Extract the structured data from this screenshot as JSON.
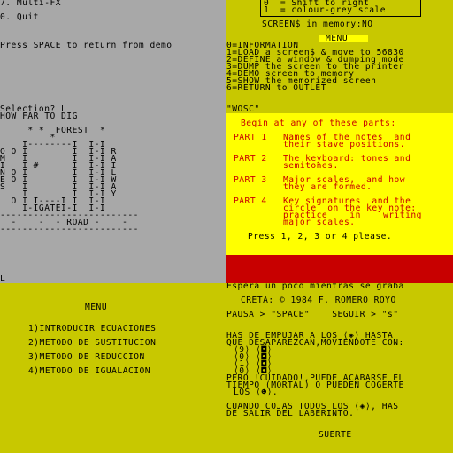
{
  "tl": {
    "line1": "7. Multi-FX",
    "line2": "0. Quit",
    "press": "Press SPACE to return from demo",
    "selection": "Selection? L",
    "dig": "HOW FAR TO DIG",
    "map": [
      "     * *  FOREST  *",
      "         *",
      "    I--------I  I-I",
      "O O I        I  I-I R",
      "M   I        I  I-I A",
      "I   I #      I  I-I I",
      "N O I        I  I-I L",
      "E O I        I  I-I W",
      "S   I        I  I-I A",
      "    I        I  I-I Y",
      "  O I I----I I  I-I",
      "    I-IGATEI-I  I-I",
      "-------------------------",
      "  -    -  - ROAD -    -",
      "-------------------------"
    ],
    "cursor": "L"
  },
  "tr": {
    "box1": "0  = Shift to right",
    "box2": "1  = colour-grey scale",
    "screens": "SCREEN$ in memory:NO",
    "menu_title": "MENU",
    "menu": [
      "0=INFORMATION",
      "1=LOAD a screen$ & move to 56830",
      "2=DEFINE a window & dumping mode",
      "3=DUMP the screen to the printer",
      "4=DEMO screen to memory",
      "5=SHOW the memorized screen",
      "6=RETURN to OUTLET"
    ]
  },
  "wosc": {
    "title": "\"WOSC\"",
    "intro": "Begin at any of these parts:",
    "parts": [
      {
        "label": "PART 1",
        "l1": "Names of the notes  and",
        "l2": "their stave positions."
      },
      {
        "label": "PART 2",
        "l1": "The keyboard: tones and",
        "l2": "semitones."
      },
      {
        "label": "PART 3",
        "l1": "Major scales,  and how",
        "l2": "they are formed."
      },
      {
        "label": "PART 4",
        "l1": "Key signatures  and the",
        "l2": "circle  on the key note:",
        "l3": "practice    in    writing",
        "l4": "major scales."
      }
    ],
    "prompt": "Press 1, 2, 3 or 4 please."
  },
  "bl": {
    "title": "MENU",
    "items": [
      "1)INTRODUCIR ECUACIONES",
      "2)METODO DE SUSTITUCION",
      "3)METODO DE REDUCCION",
      "4)METODO DE IGUALACION"
    ]
  },
  "br": {
    "espera": "Espera un poco mientras se graba",
    "creta": "CRETA: © 1984 F. ROMERO ROYO",
    "pausa": "PAUSA > \"SPACE\"    SEGUIR > \"s\"",
    "l1": "HAS DE EMPUJAR A LOS ⟨◈⟩ HASTA",
    "l2": "QUE DESAPAREZCAN,MOVIENDOTE CON:",
    "keys": [
      "⟨9⟩ ⟨◘⟩",
      "⟨0⟩ ⟨◘⟩",
      "⟨1⟩ ⟨◘⟩",
      "⟨0⟩ ⟨◘⟩"
    ],
    "l3": "PERO !CUIDADO!,PUEDE ACABARSE EL",
    "l4": "TIEMPO (MORTAL) O PUEDEN COGERTE",
    "l5": "LOS ⟨☻⟩.",
    "l6": "CUANDO COJAS TODOS LOS ⟨◈⟩, HAS",
    "l7": "DE SALIR DEL LABERINTO.",
    "suerte": "SUERTE"
  },
  "colors": {
    "grey": "#a8a8a8",
    "yellow": "#c8c800",
    "bright_yellow": "#ffff00",
    "red": "#c80000",
    "black": "#000000"
  }
}
